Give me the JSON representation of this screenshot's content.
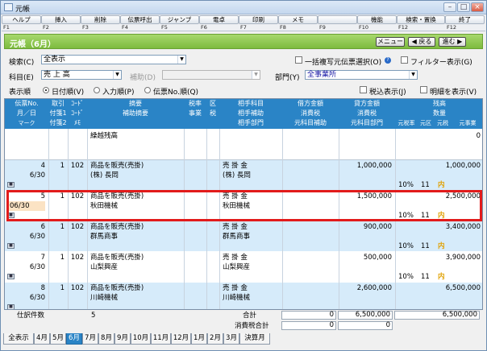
{
  "window": {
    "title": "元帳"
  },
  "fkeys": [
    {
      "label": "ヘルプ",
      "key": "F1"
    },
    {
      "label": "挿入",
      "key": "F2"
    },
    {
      "label": "削除",
      "key": "F3"
    },
    {
      "label": "伝票呼出",
      "key": "F4"
    },
    {
      "label": "ジャンプ",
      "key": "F5"
    },
    {
      "label": "電卓",
      "key": "F6"
    },
    {
      "label": "印刷",
      "key": "F7"
    },
    {
      "label": "メモ",
      "key": "F8"
    },
    {
      "label": "",
      "key": "F9"
    },
    {
      "label": "機能",
      "key": "F10"
    },
    {
      "label": "",
      "key": "F11"
    },
    {
      "label": "検索・置換",
      "key": "F12"
    },
    {
      "label": "終了",
      "key": "F12"
    }
  ],
  "header": {
    "title": "元帳（6月）",
    "menu": "メニュー",
    "back": "◀ 戻る",
    "forward": "進む ▶"
  },
  "filters": {
    "search_label": "検索(C)",
    "search_value": "全表示",
    "bulk_label": "一括複写元伝票選択(O)",
    "filter_display_label": "フィルター表示(G)",
    "account_label": "科目(E)",
    "account_value": "売 上 高",
    "sub_label": "補助(D)",
    "dept_label": "部門(Y)",
    "dept_value": "全事業所",
    "order_label": "表示順",
    "order_options": [
      "日付順(V)",
      "入力順(P)",
      "伝票No.順(Q)"
    ],
    "tax_incl_label": "税込表示(J)",
    "detail_label": "明細を表示(V)"
  },
  "grid_headers": {
    "col1": [
      "伝票No.",
      "月／日",
      "マーク"
    ],
    "col2": [
      "取引",
      "付箋1",
      "付箋2"
    ],
    "col3": [
      "ｺｰﾄﾞ",
      "ｺｰﾄﾞ",
      "ﾒﾓ"
    ],
    "summary": [
      "摘要",
      "補助摘要"
    ],
    "taxrate": "税率",
    "taxrate_sub": "事業",
    "kubun": "区",
    "kubun_sub": "税",
    "partner": [
      "相手科目",
      "相手補助",
      "相手部門"
    ],
    "debit": [
      "借方金額",
      "消費税",
      "元科目補助"
    ],
    "credit": [
      "貸方金額",
      "消費税",
      "元科目部門"
    ],
    "balance": "残高",
    "qty": "数量",
    "bal_sub": [
      "元税率",
      "元区",
      "元税",
      "元事業"
    ]
  },
  "carryover": {
    "label": "繰越残高",
    "balance": "0"
  },
  "rows": [
    {
      "no": "4",
      "date": "6/30",
      "tr": "1",
      "code": "102",
      "summary1": "商品を販売(売掛)",
      "summary2": "(株) 長岡",
      "partner1": "売 掛 金",
      "partner2": "(株) 長岡",
      "credit": "1,000,000",
      "balance": "1,000,000",
      "rate": "10%",
      "kubun": "11",
      "uchi": "内"
    },
    {
      "no": "5",
      "date": "06/30",
      "tr": "1",
      "code": "102",
      "summary1": "商品を販売(売掛)",
      "summary2": "秋田機械",
      "partner1": "売 掛 金",
      "partner2": "秋田機械",
      "credit": "1,500,000",
      "balance": "2,500,000",
      "rate": "10%",
      "kubun": "11",
      "uchi": "内"
    },
    {
      "no": "6",
      "date": "6/30",
      "tr": "1",
      "code": "102",
      "summary1": "商品を販売(売掛)",
      "summary2": "群馬商事",
      "partner1": "売 掛 金",
      "partner2": "群馬商事",
      "credit": "900,000",
      "balance": "3,400,000",
      "rate": "10%",
      "kubun": "11",
      "uchi": "内"
    },
    {
      "no": "7",
      "date": "6/30",
      "tr": "1",
      "code": "102",
      "summary1": "商品を販売(売掛)",
      "summary2": "山梨興産",
      "partner1": "売 掛 金",
      "partner2": "山梨興産",
      "credit": "500,000",
      "balance": "3,900,000",
      "rate": "10%",
      "kubun": "11",
      "uchi": "内"
    },
    {
      "no": "8",
      "date": "6/30",
      "tr": "1",
      "code": "102",
      "summary1": "商品を販売(売掛)",
      "summary2": "川崎機械",
      "partner1": "売 掛 金",
      "partner2": "川崎機械",
      "credit": "2,600,000",
      "balance": "6,500,000",
      "rate": "10%",
      "kubun": "11",
      "uchi": "内"
    }
  ],
  "totals": {
    "count_label": "仕訳件数",
    "count": "5",
    "total_label": "合計",
    "debit_total": "0",
    "credit_total": "6,500,000",
    "balance_total": "6,500,000",
    "tax_label": "消費税合計",
    "debit_tax": "0",
    "credit_tax": "0"
  },
  "tabs": [
    "全表示",
    "4月",
    "5月",
    "6月",
    "7月",
    "8月",
    "9月",
    "10月",
    "11月",
    "12月",
    "1月",
    "2月",
    "3月",
    "決算月"
  ],
  "active_tab": "6月"
}
